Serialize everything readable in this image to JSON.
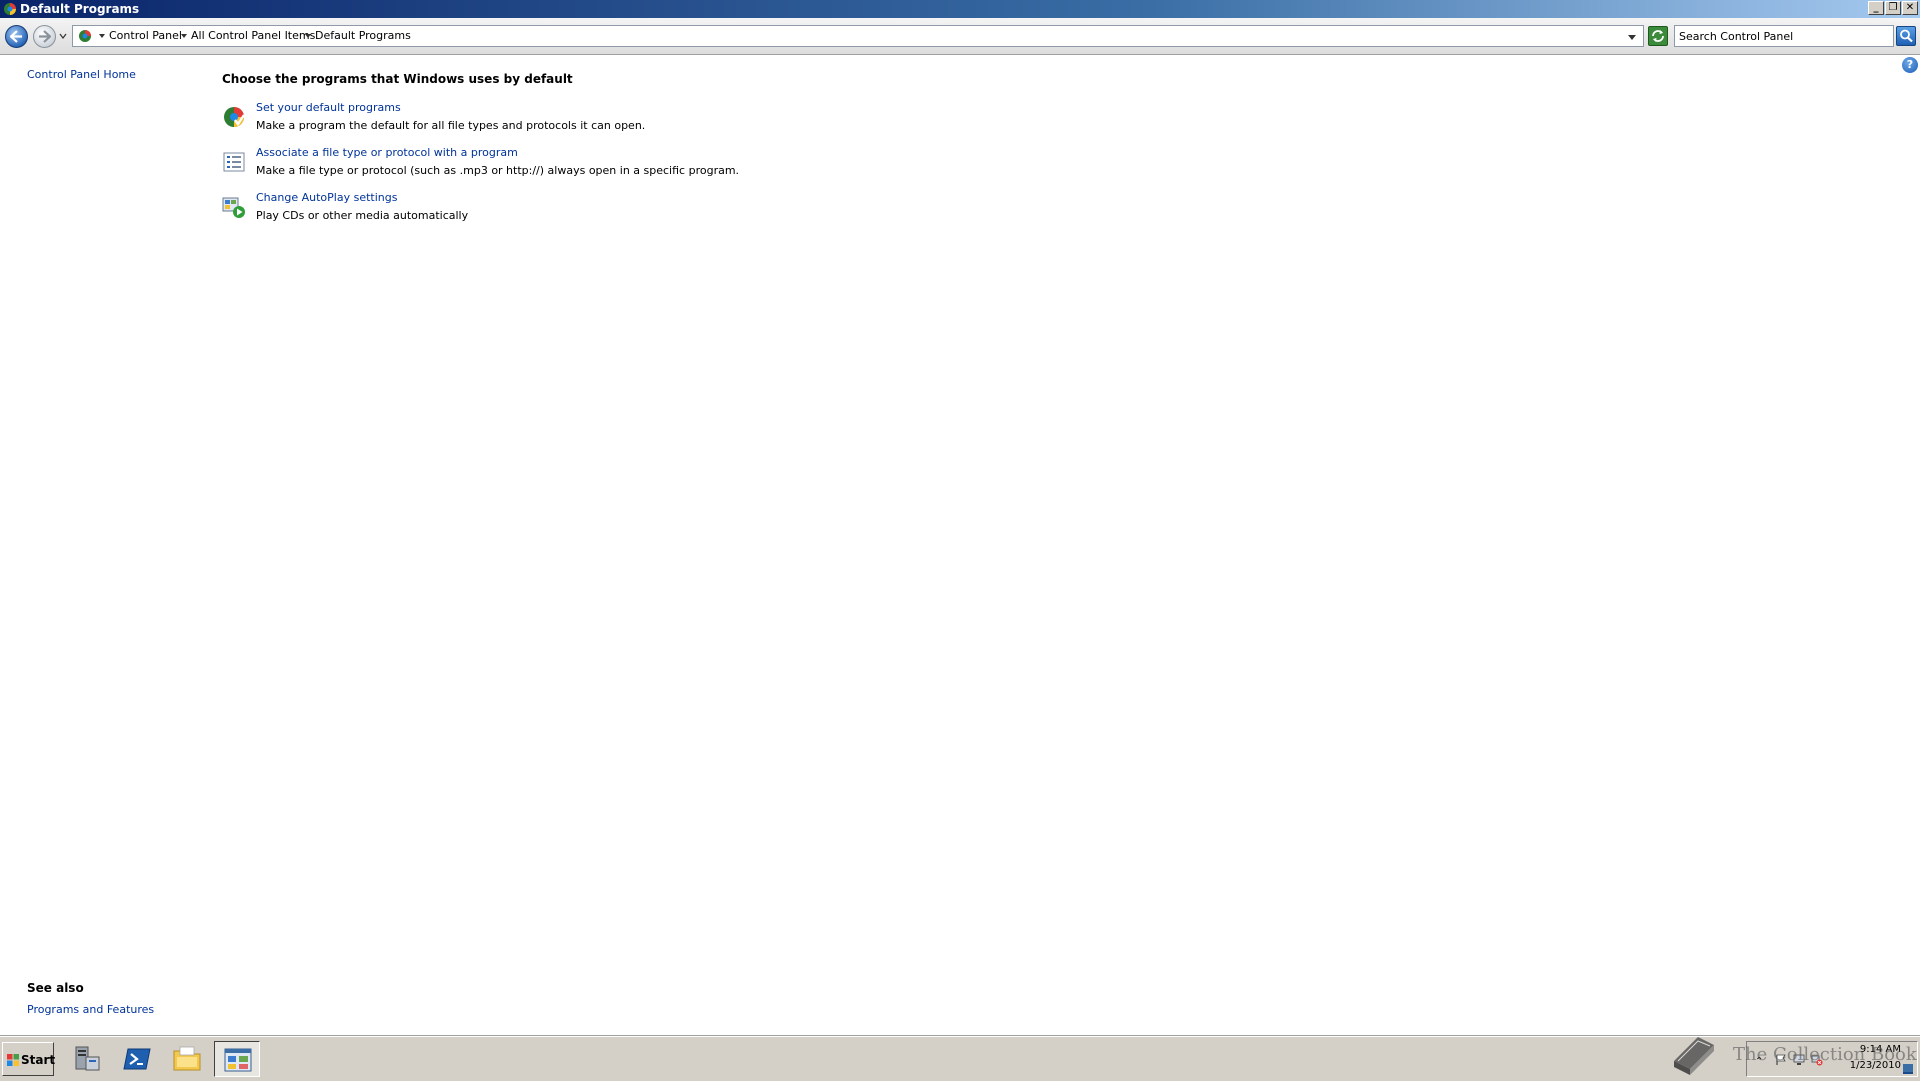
{
  "window": {
    "title": "Default Programs",
    "minimize": "_",
    "restore": "❐",
    "close": "✕"
  },
  "address": {
    "crumbs": [
      "Control Panel",
      "All Control Panel Items",
      "Default Programs"
    ],
    "search_placeholder": "Search Control Panel"
  },
  "help": {
    "symbol": "?"
  },
  "leftnav": {
    "home": "Control Panel Home",
    "see_also_title": "See also",
    "see_also_link": "Programs and Features"
  },
  "main": {
    "heading": "Choose the programs that Windows uses by default",
    "tasks": [
      {
        "link": "Set your default programs",
        "desc": "Make a program the default for all file types and protocols it can open."
      },
      {
        "link": "Associate a file type or protocol with a program",
        "desc": "Make a file type or protocol (such as .mp3 or http://) always open in a specific program."
      },
      {
        "link": "Change AutoPlay settings",
        "desc": "Play CDs or other media automatically"
      }
    ]
  },
  "taskbar": {
    "start_label": "Start",
    "clock_time": "9:14 AM",
    "clock_date": "1/23/2010",
    "tray_up": "⌃"
  },
  "watermark": {
    "text": "The Collection Book"
  },
  "colors": {
    "link": "#003399",
    "titlebar_start": "#0a246a",
    "titlebar_end": "#a6caf0",
    "taskbar": "#d4d0c8"
  }
}
